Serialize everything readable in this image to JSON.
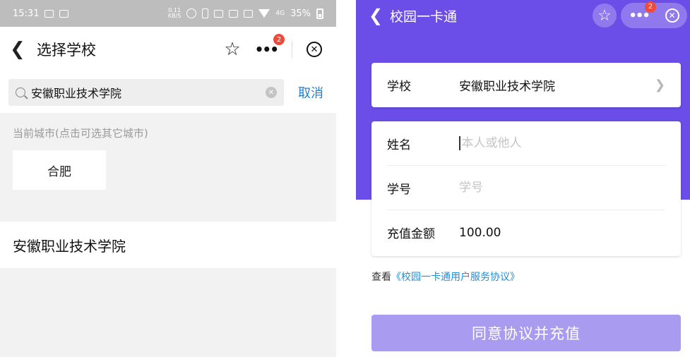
{
  "left": {
    "status_bar": {
      "time": "15:31",
      "net_speed_value": "0.11",
      "net_speed_unit": "KB/S",
      "network_label": "4G",
      "battery": "35%"
    },
    "nav": {
      "title": "选择学校",
      "badge_count": "2"
    },
    "search": {
      "value": "安徽职业技术学院",
      "cancel_label": "取消"
    },
    "city": {
      "hint": "当前城市(点击可选其它城市)",
      "current": "合肥"
    },
    "results": [
      {
        "name": "安徽职业技术学院"
      }
    ]
  },
  "right": {
    "nav": {
      "title": "校园一卡通",
      "badge_count": "2"
    },
    "school": {
      "label": "学校",
      "value": "安徽职业技术学院"
    },
    "form": {
      "name_label": "姓名",
      "name_placeholder": "本人或他人",
      "id_label": "学号",
      "id_placeholder": "学号",
      "amount_label": "充值金额",
      "amount_value": "100.00"
    },
    "agreement": {
      "prefix": "查看",
      "link": "《校园一卡通用户服务协议》"
    },
    "submit_label": "同意协议并充值"
  },
  "colors": {
    "accent_purple": "#6b4de7",
    "button_disabled": "#a99cf0",
    "link_blue": "#1e7fd4",
    "badge_red": "#f04a3a"
  },
  "icons": [
    "back-chevron-icon",
    "star-icon",
    "more-icon",
    "close-circle-icon",
    "search-icon",
    "clear-icon",
    "chevron-right-icon",
    "wifi-icon",
    "battery-icon",
    "alarm-icon",
    "nfc-icon"
  ]
}
